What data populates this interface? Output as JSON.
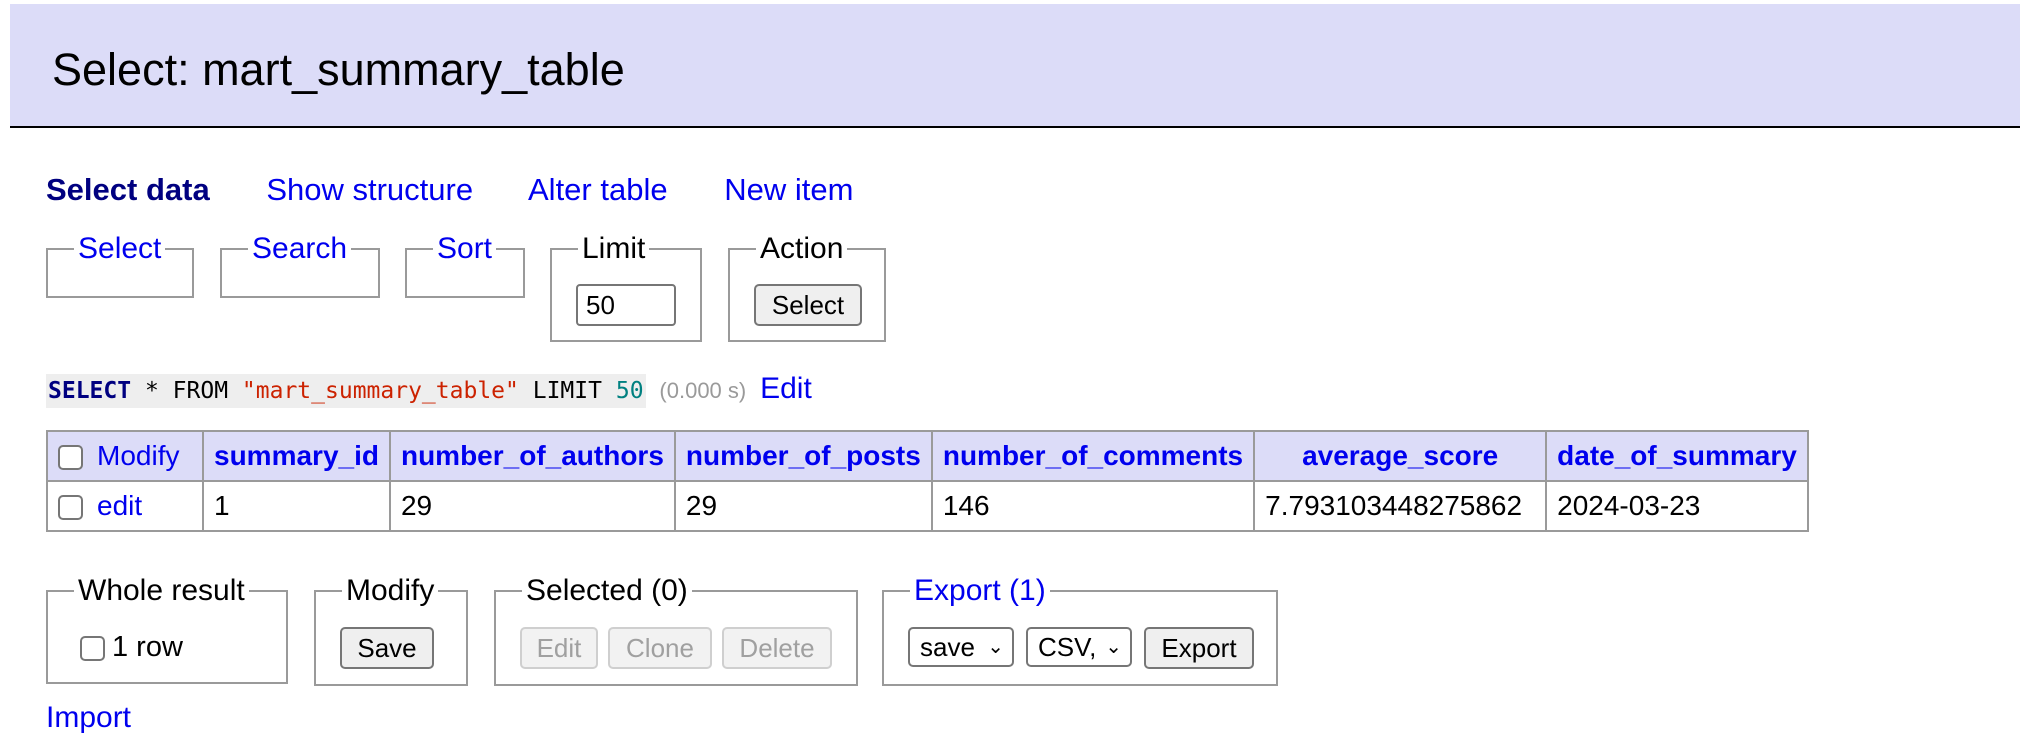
{
  "header": {
    "title": "Select: mart_summary_table"
  },
  "tabs": {
    "select_data": "Select data",
    "show_structure": "Show structure",
    "alter_table": "Alter table",
    "new_item": "New item"
  },
  "filters": {
    "select": "Select",
    "search": "Search",
    "sort": "Sort",
    "limit_legend": "Limit",
    "limit_value": "50",
    "action_legend": "Action",
    "action_button": "Select"
  },
  "query": {
    "select_kw": "SELECT",
    "star": "*",
    "from_kw": "FROM",
    "table": "\"mart_summary_table\"",
    "limit_kw": "LIMIT",
    "limit_num": "50",
    "time": "(0.000 s)",
    "edit": "Edit"
  },
  "table": {
    "modify_header": "Modify",
    "columns": [
      "summary_id",
      "number_of_authors",
      "number_of_posts",
      "number_of_comments",
      "average_score",
      "date_of_summary"
    ],
    "rows": [
      {
        "edit": "edit",
        "cells": [
          "1",
          "29",
          "29",
          "146",
          "7.793103448275862",
          "2024-03-23"
        ]
      }
    ]
  },
  "footer": {
    "whole_result_legend": "Whole result",
    "whole_result_label": "1 row",
    "modify_legend": "Modify",
    "save": "Save",
    "selected_legend": "Selected (0)",
    "edit": "Edit",
    "clone": "Clone",
    "delete": "Delete",
    "export_legend": "Export (1)",
    "output_select": "save",
    "format_select": "CSV,",
    "export_button": "Export",
    "import": "Import"
  }
}
